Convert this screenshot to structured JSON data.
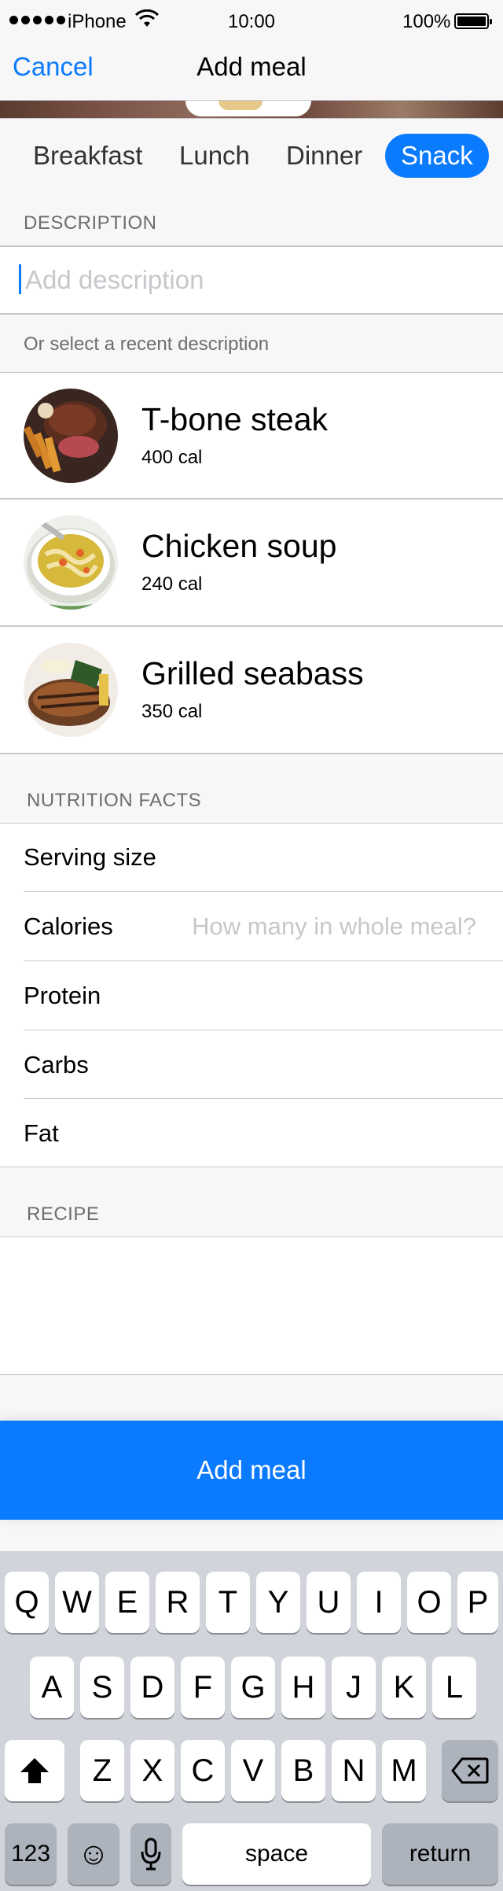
{
  "status_bar": {
    "carrier": "iPhone",
    "time": "10:00",
    "battery": "100%"
  },
  "nav": {
    "cancel": "Cancel",
    "title": "Add meal"
  },
  "meal_types": {
    "items": [
      "Breakfast",
      "Lunch",
      "Dinner",
      "Snack"
    ],
    "selected": "Snack"
  },
  "description": {
    "header": "DESCRIPTION",
    "placeholder": "Add description",
    "value": "",
    "recent_hint": "Or select a recent description"
  },
  "recent_meals": [
    {
      "name": "T-bone steak",
      "calories": "400 cal"
    },
    {
      "name": "Chicken soup",
      "calories": "240 cal"
    },
    {
      "name": "Grilled seabass",
      "calories": "350 cal"
    }
  ],
  "nutrition": {
    "header": "NUTRITION FACTS",
    "serving_size": {
      "label": "Serving size",
      "placeholder": ""
    },
    "calories": {
      "label": "Calories",
      "placeholder": "How many in whole meal?"
    },
    "protein": {
      "label": "Protein",
      "placeholder": ""
    },
    "carbs": {
      "label": "Carbs",
      "placeholder": ""
    },
    "fat": {
      "label": "Fat",
      "placeholder": ""
    }
  },
  "recipe": {
    "header": "RECIPE",
    "value": ""
  },
  "add_button": "Add meal",
  "keyboard": {
    "row1": [
      "Q",
      "W",
      "E",
      "R",
      "T",
      "Y",
      "U",
      "I",
      "O",
      "P"
    ],
    "row2": [
      "A",
      "S",
      "D",
      "F",
      "G",
      "H",
      "J",
      "K",
      "L"
    ],
    "row3": [
      "Z",
      "X",
      "C",
      "V",
      "B",
      "N",
      "M"
    ],
    "numbers": "123",
    "emoji": "☺",
    "space": "space",
    "return": "return"
  },
  "colors": {
    "accent": "#0a7aff",
    "keyboard_bg": "#d1d5db",
    "separator": "#c8c7cc"
  }
}
